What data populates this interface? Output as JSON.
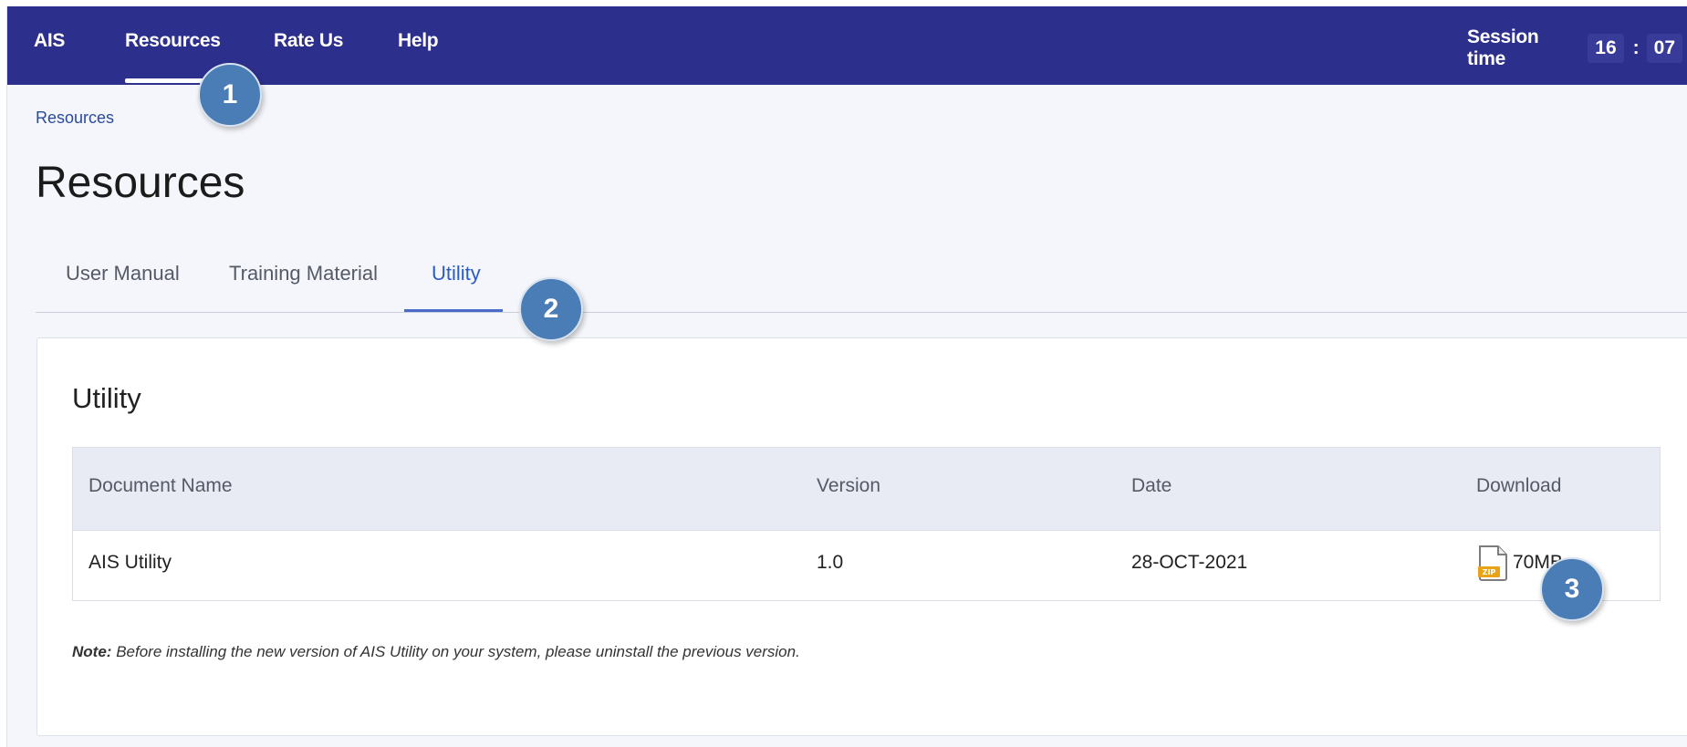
{
  "nav": {
    "items": [
      "AIS",
      "Resources",
      "Rate Us",
      "Help"
    ],
    "session_label": "Session time",
    "session_hours": "16",
    "session_separator": ":",
    "session_minutes": "07"
  },
  "breadcrumb": "Resources",
  "page_title": "Resources",
  "tabs": [
    "User Manual",
    "Training Material",
    "Utility"
  ],
  "active_tab": "Utility",
  "card": {
    "title": "Utility",
    "table": {
      "headers": [
        "Document Name",
        "Version",
        "Date",
        "Download"
      ],
      "rows": [
        {
          "document_name": "AIS Utility",
          "version": "1.0",
          "date": "28-OCT-2021",
          "download_size": "70MB",
          "download_icon": "zip-file-icon"
        }
      ]
    },
    "note_label": "Note:",
    "note_text": "Before installing the new version of AIS Utility on your system, please uninstall the previous version."
  },
  "callouts": [
    "1",
    "2",
    "3"
  ],
  "colors": {
    "nav_bg": "#2d2f8c",
    "accent": "#2d5cc4",
    "callout": "#4a7db5",
    "page_bg": "#f4f6fb",
    "table_header_bg": "#e8ebf3"
  }
}
